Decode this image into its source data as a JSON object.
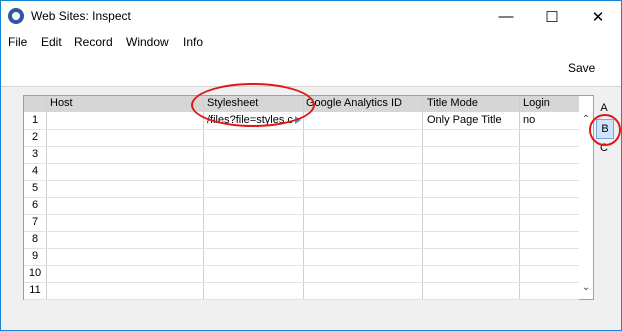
{
  "window": {
    "title": "Web Sites: Inspect",
    "minimize_glyph": "—",
    "maximize_glyph": "☐",
    "close_glyph": "✕"
  },
  "menu": [
    "File",
    "Edit",
    "Record",
    "Window",
    "Info"
  ],
  "toolbar": {
    "save_label": "Save"
  },
  "grid": {
    "columns": [
      "Host",
      "Stylesheet",
      "Google Analytics ID",
      "Title Mode",
      "Login"
    ],
    "row_numbers": [
      "1",
      "2",
      "3",
      "4",
      "5",
      "6",
      "7",
      "8",
      "9",
      "10",
      "11"
    ],
    "rows": [
      {
        "host": "",
        "stylesheet": "/files?file=styles.c",
        "analytics": "",
        "title_mode": "Only Page Title",
        "login": "no"
      }
    ]
  },
  "side_tabs": [
    "A",
    "B",
    "C"
  ],
  "selected_tab": "B",
  "colors": {
    "annotation": "#e01818",
    "title_border": "#1883d7",
    "tab_highlight": "#cfe4fa"
  }
}
